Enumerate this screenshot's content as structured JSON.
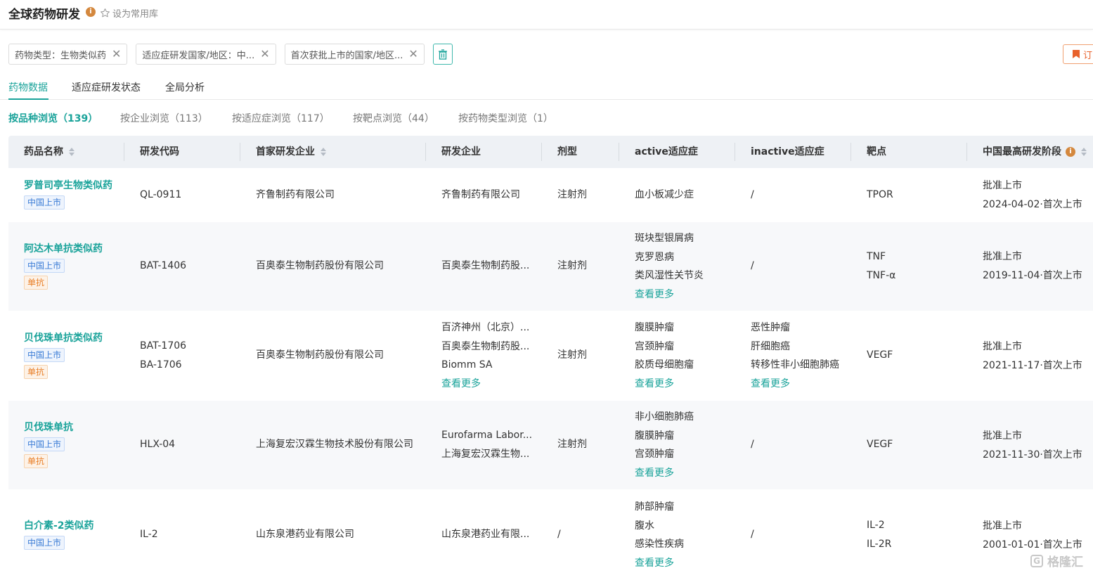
{
  "header": {
    "title": "全球药物研发",
    "favorite_label": "设为常用库"
  },
  "filters": [
    {
      "label": "药物类型：生物类似药"
    },
    {
      "label": "适应症研发国家/地区：中..."
    },
    {
      "label": "首次获批上市的国家/地区..."
    }
  ],
  "bookmark_label": "订",
  "tabs": [
    {
      "label": "药物数据"
    },
    {
      "label": "适应症研发状态"
    },
    {
      "label": "全局分析"
    }
  ],
  "subnav": [
    {
      "label": "按品种浏览（139）"
    },
    {
      "label": "按企业浏览（113）"
    },
    {
      "label": "按适应症浏览（117）"
    },
    {
      "label": "按靶点浏览（44）"
    },
    {
      "label": "按药物类型浏览（1）"
    }
  ],
  "columns": [
    {
      "label": "药品名称"
    },
    {
      "label": "研发代码"
    },
    {
      "label": "首家研发企业"
    },
    {
      "label": "研发企业"
    },
    {
      "label": "剂型"
    },
    {
      "label": "active适应症"
    },
    {
      "label": "inactive适应症"
    },
    {
      "label": "靶点"
    },
    {
      "label": "中国最高研发阶段"
    }
  ],
  "rows": [
    {
      "name": "罗普司亭生物类似药",
      "tags": {
        "market": "中国上市",
        "type": null
      },
      "codes": [
        "QL-0911"
      ],
      "first_company": "齐鲁制药有限公司",
      "companies": [
        "齐鲁制药有限公司"
      ],
      "companies_more": null,
      "dosage": "注射剂",
      "active": [
        "血小板减少症"
      ],
      "active_more": null,
      "inactive": [
        "/"
      ],
      "inactive_more": null,
      "targets": [
        "TPOR"
      ],
      "stage": "批准上市",
      "stage_date": "2024-04-02·首次上市"
    },
    {
      "name": "阿达木单抗类似药",
      "tags": {
        "market": "中国上市",
        "type": "单抗"
      },
      "codes": [
        "BAT-1406"
      ],
      "first_company": "百奥泰生物制药股份有限公司",
      "companies": [
        "百奥泰生物制药股..."
      ],
      "companies_more": null,
      "dosage": "注射剂",
      "active": [
        "斑块型银屑病",
        "克罗恩病",
        "类风湿性关节炎"
      ],
      "active_more": "查看更多",
      "inactive": [
        "/"
      ],
      "inactive_more": null,
      "targets": [
        "TNF",
        "TNF-α"
      ],
      "stage": "批准上市",
      "stage_date": "2019-11-04·首次上市"
    },
    {
      "name": "贝伐珠单抗类似药",
      "tags": {
        "market": "中国上市",
        "type": "单抗"
      },
      "codes": [
        "BAT-1706",
        "BA-1706"
      ],
      "first_company": "百奥泰生物制药股份有限公司",
      "companies": [
        "百济神州（北京）...",
        "百奥泰生物制药股...",
        "Biomm SA"
      ],
      "companies_more": "查看更多",
      "dosage": "注射剂",
      "active": [
        "腹膜肿瘤",
        "宫颈肿瘤",
        "胶质母细胞瘤"
      ],
      "active_more": "查看更多",
      "inactive": [
        "恶性肿瘤",
        "肝细胞癌",
        "转移性非小细胞肺癌"
      ],
      "inactive_more": "查看更多",
      "targets": [
        "VEGF"
      ],
      "stage": "批准上市",
      "stage_date": "2021-11-17·首次上市"
    },
    {
      "name": "贝伐珠单抗",
      "tags": {
        "market": "中国上市",
        "type": "单抗"
      },
      "codes": [
        "HLX-04"
      ],
      "first_company": "上海复宏汉霖生物技术股份有限公司",
      "companies": [
        "Eurofarma Labor...",
        "上海复宏汉霖生物..."
      ],
      "companies_more": null,
      "dosage": "注射剂",
      "active": [
        "非小细胞肺癌",
        "腹膜肿瘤",
        "宫颈肿瘤"
      ],
      "active_more": "查看更多",
      "inactive": [
        "/"
      ],
      "inactive_more": null,
      "targets": [
        "VEGF"
      ],
      "stage": "批准上市",
      "stage_date": "2021-11-30·首次上市"
    },
    {
      "name": "白介素-2类似药",
      "tags": {
        "market": "中国上市",
        "type": null
      },
      "codes": [
        "IL-2"
      ],
      "first_company": "山东泉港药业有限公司",
      "companies": [
        "山东泉港药业有限..."
      ],
      "companies_more": null,
      "dosage": "/",
      "active": [
        "肺部肿瘤",
        "腹水",
        "感染性疾病"
      ],
      "active_more": "查看更多",
      "inactive": [
        "/"
      ],
      "inactive_more": null,
      "targets": [
        "IL-2",
        "IL-2R"
      ],
      "stage": "批准上市",
      "stage_date": "2001-01-01·首次上市"
    }
  ],
  "watermark": "格隆汇",
  "colors": {
    "accent": "#1aa39a",
    "tag_blue": "#3a7bd5",
    "tag_orange": "#e87d24",
    "info_orange": "#d4883e"
  }
}
